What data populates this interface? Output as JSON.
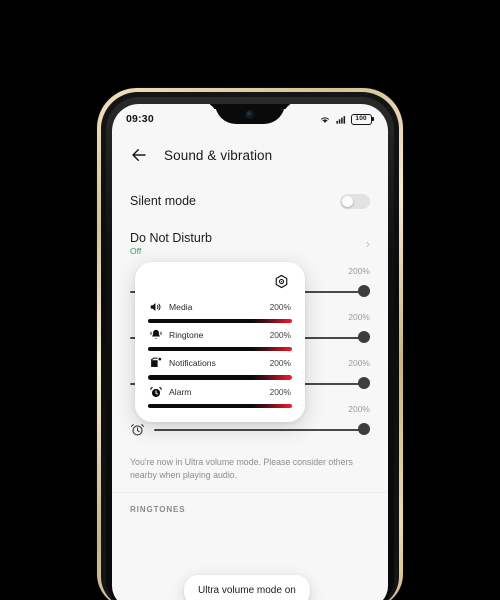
{
  "statusbar": {
    "time": "09:30",
    "wifi_icon": "wifi-icon",
    "signal_icon": "cellular-signal-icon",
    "battery_level": "100"
  },
  "header": {
    "back_icon": "back-arrow-icon",
    "title": "Sound & vibration"
  },
  "settings": {
    "silent_mode": {
      "label": "Silent mode",
      "toggle_state": "off"
    },
    "do_not_disturb": {
      "label": "Do Not Disturb",
      "status": "Off",
      "status_color": "#2fa05a",
      "chevron": "›"
    }
  },
  "background_sliders": [
    {
      "name": "media-volume-slider",
      "percent": "200%",
      "icon": ""
    },
    {
      "name": "ringtone-volume-slider",
      "percent": "200%",
      "icon": ""
    },
    {
      "name": "notifications-volume-slider",
      "percent": "200%",
      "icon": ""
    },
    {
      "name": "alarm-volume-slider",
      "percent": "200%",
      "icon": "alarm-clock-icon"
    }
  ],
  "hint": {
    "text": "You're now in Ultra volume mode. Please consider others nearby when playing audio."
  },
  "section": {
    "ringtones_label": "RINGTONES"
  },
  "volume_popup": {
    "gear_icon": "settings-gear-icon",
    "items": [
      {
        "icon": "speaker-volume-icon",
        "label": "Media",
        "percent": "200%",
        "fill": 100
      },
      {
        "icon": "ringtone-bell-icon",
        "label": "Ringtone",
        "percent": "200%",
        "fill": 100
      },
      {
        "icon": "notification-box-icon",
        "label": "Notifications",
        "percent": "200%",
        "fill": 100
      },
      {
        "icon": "alarm-clock-icon",
        "label": "Alarm",
        "percent": "200%",
        "fill": 100
      }
    ]
  },
  "toast": {
    "message": "Ultra volume mode on"
  },
  "colors": {
    "accent_red": "#f01e2c",
    "track_black": "#0b0b0b",
    "status_green": "#2fa05a",
    "screen_bg": "#f7f7f7"
  }
}
